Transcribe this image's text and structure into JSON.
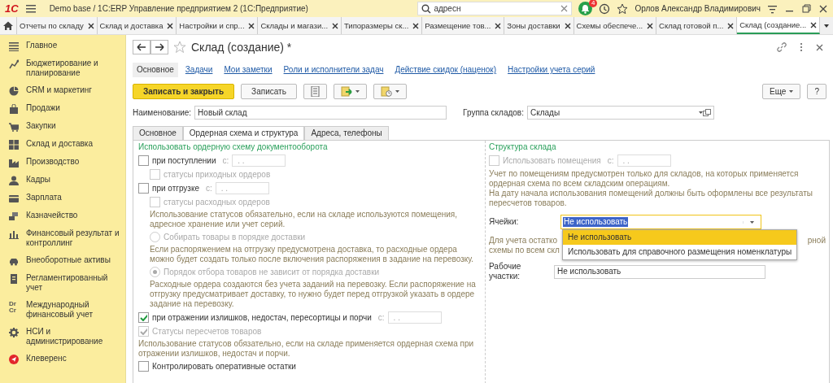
{
  "app_bar": {
    "logo": "1С",
    "title": "Demo base / 1С:ERP Управление предприятием 2  (1С:Предприятие)",
    "search_value": "адресн",
    "notification_count": "4",
    "user": "Орлов Александр Владимирович"
  },
  "open_tabs": [
    {
      "label": "Отчеты по складу",
      "selected": false
    },
    {
      "label": "Склад и доставка",
      "selected": false
    },
    {
      "label": "Настройки и спр...",
      "selected": false
    },
    {
      "label": "Склады и магази...",
      "selected": false
    },
    {
      "label": "Типоразмеры ск...",
      "selected": false
    },
    {
      "label": "Размещение тов...",
      "selected": false
    },
    {
      "label": "Зоны доставки",
      "selected": false
    },
    {
      "label": "Схемы обеспече...",
      "selected": false
    },
    {
      "label": "Склад готовой п...",
      "selected": false
    },
    {
      "label": "Склад (создание...",
      "selected": true
    }
  ],
  "sidebar": {
    "items": [
      {
        "label": "Главное"
      },
      {
        "label": "Бюджетирование и планирование"
      },
      {
        "label": "CRM и маркетинг"
      },
      {
        "label": "Продажи"
      },
      {
        "label": "Закупки"
      },
      {
        "label": "Склад и доставка"
      },
      {
        "label": "Производство"
      },
      {
        "label": "Кадры"
      },
      {
        "label": "Зарплата"
      },
      {
        "label": "Казначейство"
      },
      {
        "label": "Финансовый результат и контроллинг"
      },
      {
        "label": "Внеоборотные активы"
      },
      {
        "label": "Регламентированный учет"
      },
      {
        "label": "Международный финансовый учет",
        "icon_text": "Dr Cr"
      },
      {
        "label": "НСИ и администрирование"
      },
      {
        "label": "Клеверенс"
      }
    ]
  },
  "form": {
    "title": "Склад (создание) *",
    "sections": [
      {
        "label": "Основное",
        "selected": true
      },
      {
        "label": "Задачи",
        "selected": false
      },
      {
        "label": "Мои заметки",
        "selected": false
      },
      {
        "label": "Роли и исполнители задач",
        "selected": false
      },
      {
        "label": "Действие скидок (наценок)",
        "selected": false
      },
      {
        "label": "Настройки учета серий",
        "selected": false
      }
    ],
    "toolbar": {
      "save_close": "Записать и закрыть",
      "save": "Записать",
      "more": "Еще",
      "help": "?"
    },
    "name": {
      "label": "Наименование:",
      "value": "Новый склад"
    },
    "group": {
      "label": "Группа складов:",
      "value": "Склады"
    },
    "tabs": [
      {
        "label": "Основное",
        "selected": false
      },
      {
        "label": "Ордерная схема и структура",
        "selected": true
      },
      {
        "label": "Адреса, телефоны",
        "selected": false
      }
    ],
    "order_scheme": {
      "heading": "Использовать ордерную схему документооборота",
      "items": [
        {
          "kind": "checkbox",
          "label": "при поступлении",
          "checked": false,
          "disabled": false,
          "date_label": "с:",
          "date_value": ". .",
          "children": [
            {
              "kind": "checkbox",
              "label": "статусы приходных ордеров",
              "checked": false,
              "disabled": true
            }
          ]
        },
        {
          "kind": "checkbox",
          "label": "при отгрузке",
          "checked": false,
          "disabled": false,
          "date_label": "с:",
          "date_value": ". .",
          "children": [
            {
              "kind": "checkbox",
              "label": "статусы расходных ордеров",
              "checked": false,
              "disabled": true
            },
            {
              "kind": "note",
              "text": "Использование статусов обязательно, если на складе используются помещения, адресное хранение или учет серий."
            },
            {
              "kind": "radio",
              "label": "Собирать товары в порядке доставки",
              "selected": false,
              "disabled": true
            },
            {
              "kind": "note",
              "text": "Если распоряжением на отгрузку предусмотрена доставка, то расходные ордера можно будет создать только после включения распоряжения в задание на перевозку."
            },
            {
              "kind": "radio",
              "label": "Порядок отбора товаров не зависит от порядка доставки",
              "selected": true,
              "disabled": true
            },
            {
              "kind": "note",
              "text": "Расходные ордера создаются без учета заданий на перевозку. Если распоряжение на отгрузку предусматривает доставку, то нужно будет перед отгрузкой указать в ордере задание на перевозку."
            }
          ]
        },
        {
          "kind": "checkbox",
          "label": "при отражении излишков, недостач, пересортицы и порчи",
          "checked": true,
          "disabled": false,
          "date_label": "с:",
          "date_value": ". ."
        },
        {
          "kind": "checkbox",
          "label": "Статусы пересчетов товаров",
          "checked": true,
          "disabled": true
        },
        {
          "kind": "note",
          "text": "Использование статусов обязательно, если на складе применяется ордерная схема при отражении излишков, недостач и порчи."
        },
        {
          "kind": "checkbox",
          "label": "Контролировать оперативные остатки",
          "checked": false,
          "disabled": false
        }
      ]
    },
    "structure": {
      "heading": "Структура склада",
      "use_rooms": {
        "label": "Использовать помещения",
        "checked": false,
        "disabled": true,
        "date_label": "с:",
        "date_value": ". ."
      },
      "note_lines": [
        "Учет по помещениям предусмотрен только для складов, на которых применяется ордерная схема по всем складским операциям.",
        "На дату начала использования помещений должны быть оформлены все результаты пересчетов товаров."
      ],
      "cells": {
        "label": "Ячейки:",
        "value": "Не использовать",
        "expanded": true,
        "options": [
          {
            "label": "Не использовать",
            "selected": true
          },
          {
            "label": "Использовать для справочного размещения номенклатуры",
            "selected": false
          }
        ]
      },
      "cells_note_visible": [
        "Для учета остатко",
        "рной",
        "схемы по всем скл"
      ],
      "work_areas": {
        "label": "Рабочие участки:",
        "value": "Не использовать"
      }
    }
  }
}
